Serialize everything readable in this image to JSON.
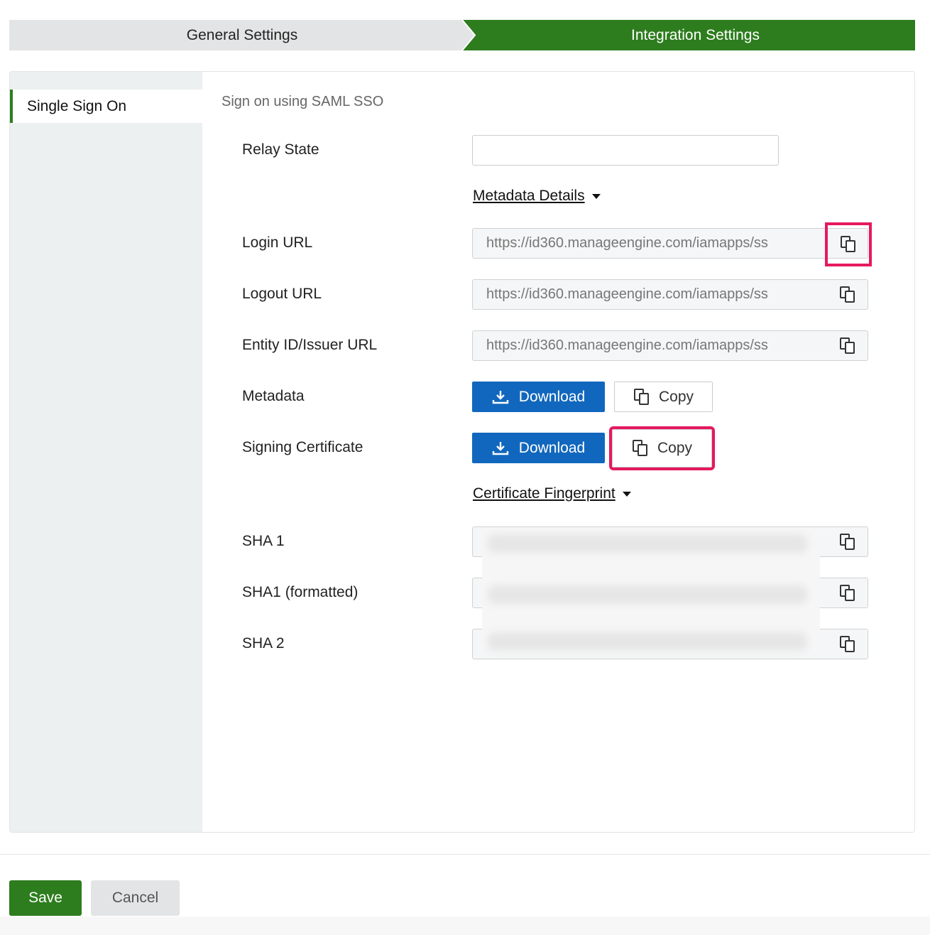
{
  "stepper": {
    "steps": [
      {
        "label": "General Settings",
        "state": "inactive"
      },
      {
        "label": "Integration Settings",
        "state": "active"
      }
    ],
    "active_color": "#2d7d1e",
    "inactive_color": "#e3e4e5"
  },
  "sidebar": {
    "items": [
      {
        "label": "Single Sign On",
        "selected": true
      }
    ]
  },
  "main": {
    "section_title": "Sign on using SAML SSO",
    "relay_state": {
      "label": "Relay State",
      "value": ""
    },
    "metadata_details": {
      "label": "Metadata Details"
    },
    "login_url": {
      "label": "Login URL",
      "value": "https://id360.manageengine.com/iamapps/ss"
    },
    "logout_url": {
      "label": "Logout URL",
      "value": "https://id360.manageengine.com/iamapps/ss"
    },
    "entity_id": {
      "label": "Entity ID/Issuer URL",
      "value": "https://id360.manageengine.com/iamapps/ss"
    },
    "metadata": {
      "label": "Metadata",
      "download_label": "Download",
      "copy_label": "Copy"
    },
    "signing_certificate": {
      "label": "Signing Certificate",
      "download_label": "Download",
      "copy_label": "Copy"
    },
    "certificate_fingerprint": {
      "label": "Certificate Fingerprint"
    },
    "sha1": {
      "label": "SHA 1"
    },
    "sha1_formatted": {
      "label": "SHA1 (formatted)"
    },
    "sha2": {
      "label": "SHA 2"
    }
  },
  "footer": {
    "save_label": "Save",
    "cancel_label": "Cancel"
  },
  "colors": {
    "primary_blue": "#1167bd",
    "highlight": "#e5195f"
  }
}
